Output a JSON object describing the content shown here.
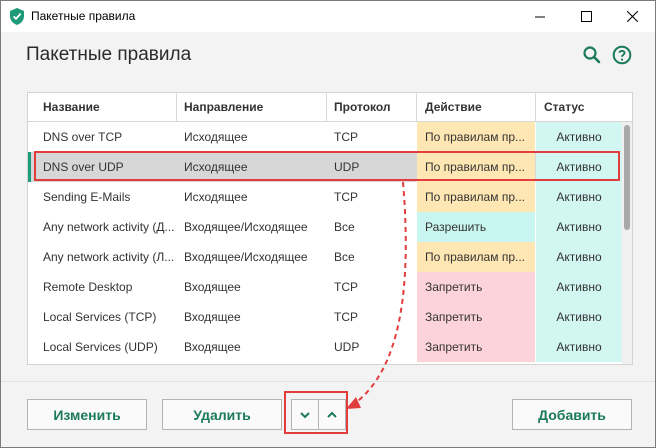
{
  "window": {
    "title": "Пакетные правила"
  },
  "header": {
    "title": "Пакетные правила",
    "search_icon": "search-icon",
    "help_icon": "help-icon"
  },
  "table": {
    "columns": [
      "Название",
      "Направление",
      "Протокол",
      "Действие",
      "Статус"
    ],
    "rows": [
      {
        "name": "DNS over TCP",
        "direction": "Исходящее",
        "protocol": "TCP",
        "action": "По правилам пр...",
        "action_color": "#ffe7b3",
        "status": "Активно",
        "selected": false
      },
      {
        "name": "DNS over UDP",
        "direction": "Исходящее",
        "protocol": "UDP",
        "action": "По правилам пр...",
        "action_color": "#ffe7b3",
        "status": "Активно",
        "selected": true
      },
      {
        "name": "Sending E-Mails",
        "direction": "Исходящее",
        "protocol": "TCP",
        "action": "По правилам пр...",
        "action_color": "#ffe7b3",
        "status": "Активно",
        "selected": false
      },
      {
        "name": "Any network activity (Д...",
        "direction": "Входящее/Исходящее",
        "protocol": "Все",
        "action": "Разрешить",
        "action_color": "#c9f5f0",
        "status": "Активно",
        "selected": false
      },
      {
        "name": "Any network activity (Л...",
        "direction": "Входящее/Исходящее",
        "protocol": "Все",
        "action": "По правилам пр...",
        "action_color": "#ffe7b3",
        "status": "Активно",
        "selected": false
      },
      {
        "name": "Remote Desktop",
        "direction": "Входящее",
        "protocol": "TCP",
        "action": "Запретить",
        "action_color": "#fcd3d8",
        "status": "Активно",
        "selected": false
      },
      {
        "name": "Local Services (TCP)",
        "direction": "Входящее",
        "protocol": "TCP",
        "action": "Запретить",
        "action_color": "#fcd3d8",
        "status": "Активно",
        "selected": false
      },
      {
        "name": "Local Services (UDP)",
        "direction": "Входящее",
        "protocol": "UDP",
        "action": "Запретить",
        "action_color": "#fcd3d8",
        "status": "Активно",
        "selected": false
      }
    ],
    "status_color": "#d2f7f3"
  },
  "footer": {
    "edit_label": "Изменить",
    "delete_label": "Удалить",
    "add_label": "Добавить",
    "move_down_icon": "chevron-down-icon",
    "move_up_icon": "chevron-up-icon"
  },
  "colors": {
    "accent": "#1b7a5a",
    "annotation": "#e23d3d"
  }
}
